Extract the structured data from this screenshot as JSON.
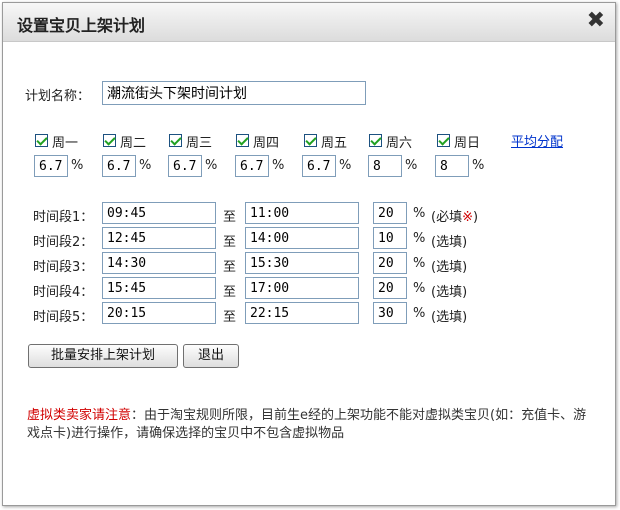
{
  "dialog": {
    "title": "设置宝贝上架计划",
    "close_glyph": "✖"
  },
  "plan": {
    "label": "计划名称：",
    "value": "潮流街头下架时间计划"
  },
  "days": [
    {
      "name": "周一",
      "checked": true,
      "value": "6.7"
    },
    {
      "name": "周二",
      "checked": true,
      "value": "6.7"
    },
    {
      "name": "周三",
      "checked": true,
      "value": "6.7"
    },
    {
      "name": "周四",
      "checked": true,
      "value": "6.7"
    },
    {
      "name": "周五",
      "checked": true,
      "value": "6.7"
    },
    {
      "name": "周六",
      "checked": true,
      "value": "8"
    },
    {
      "name": "周日",
      "checked": true,
      "value": "8"
    }
  ],
  "percent_sign": "%",
  "average_link": "平均分配",
  "to_label": "至",
  "slots": [
    {
      "label": "时间段1：",
      "start": "09:45",
      "end": "11:00",
      "percent": "20",
      "note": "(必填",
      "note_mark": "※",
      "note_end": ")"
    },
    {
      "label": "时间段2：",
      "start": "12:45",
      "end": "14:00",
      "percent": "10",
      "note": "(选填)",
      "note_mark": "",
      "note_end": ""
    },
    {
      "label": "时间段3：",
      "start": "14:30",
      "end": "15:30",
      "percent": "20",
      "note": "(选填)",
      "note_mark": "",
      "note_end": ""
    },
    {
      "label": "时间段4：",
      "start": "15:45",
      "end": "17:00",
      "percent": "20",
      "note": "(选填)",
      "note_mark": "",
      "note_end": ""
    },
    {
      "label": "时间段5：",
      "start": "20:15",
      "end": "22:15",
      "percent": "30",
      "note": "(选填)",
      "note_mark": "",
      "note_end": ""
    }
  ],
  "buttons": {
    "schedule": "批量安排上架计划",
    "exit": "退出"
  },
  "notice": {
    "warn": "虚拟类卖家请注意",
    "text": "：由于淘宝规则所限，目前生e经的上架功能不能对虚拟类宝贝(如：充值卡、游戏点卡)进行操作，请确保选择的宝贝中不包含虚拟物品"
  }
}
